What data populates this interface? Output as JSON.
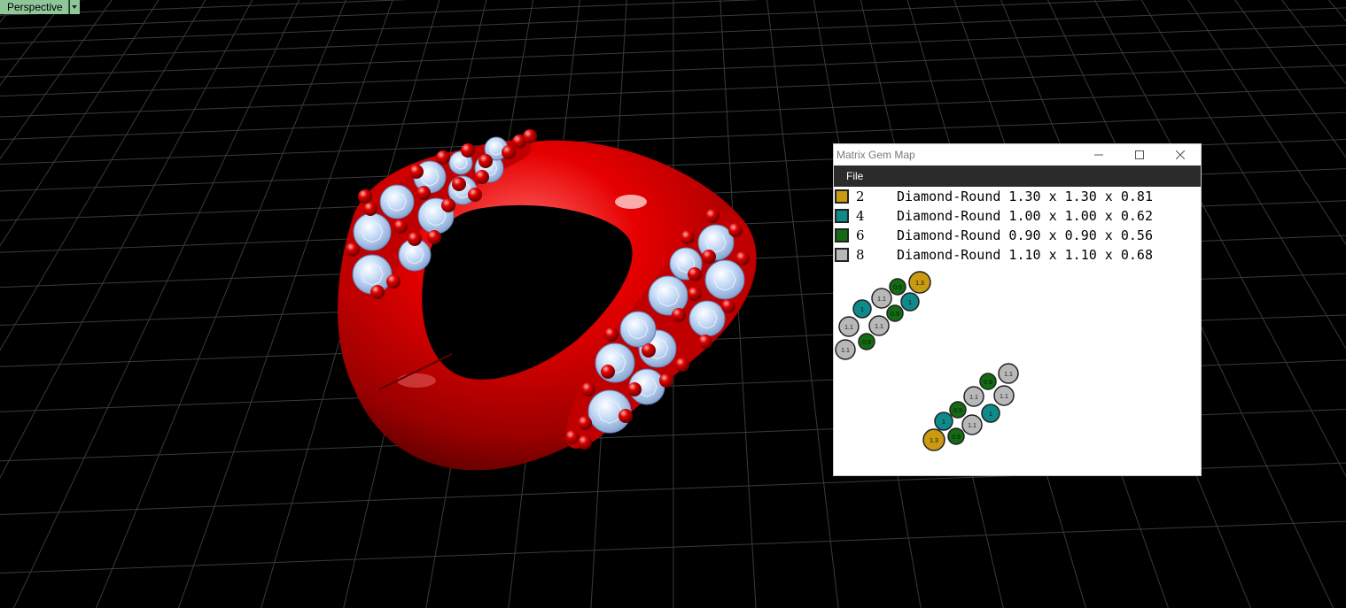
{
  "viewport": {
    "name": "Perspective",
    "menu_icon": "dropdown-arrow-icon",
    "background": "#000000",
    "grid_color": "#3a3a3a",
    "model_color": "#e00000",
    "gem_color": "#b9d3f5"
  },
  "gem_window": {
    "title": "Matrix Gem Map",
    "controls": [
      "minimize-icon",
      "maximize-icon",
      "close-icon"
    ],
    "menu": [
      "File"
    ],
    "legend": [
      {
        "count": "2",
        "spec": "Diamond-Round 1.30 x 1.30 x 0.81",
        "color": "#c99a12"
      },
      {
        "count": "4",
        "spec": "Diamond-Round 1.00 x 1.00 x 0.62",
        "color": "#0f8a8a"
      },
      {
        "count": "6",
        "spec": "Diamond-Round 0.90 x 0.90 x 0.56",
        "color": "#136b13"
      },
      {
        "count": "8",
        "spec": "Diamond-Round 1.10 x 1.10 x 0.68",
        "color": "#b8b8b8"
      }
    ],
    "map_labels": {
      "size_1_3": "1.3",
      "size_1_0": "1",
      "size_0_9": "0.9",
      "size_1_1": "1.1"
    }
  }
}
